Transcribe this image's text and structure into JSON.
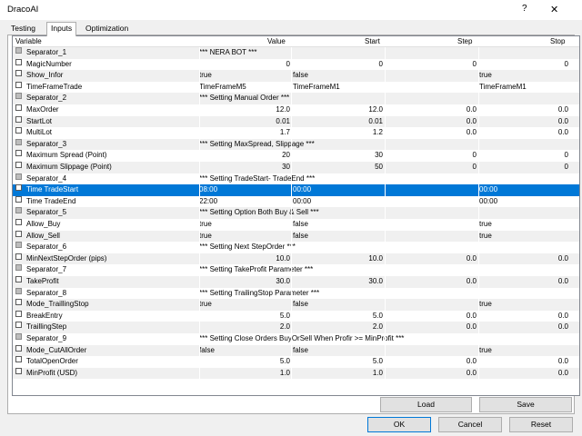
{
  "window": {
    "title": "DracoAI",
    "help": "?",
    "close": "✕"
  },
  "tabs": [
    {
      "label": "Testing"
    },
    {
      "label": "Inputs"
    },
    {
      "label": "Optimization"
    }
  ],
  "columns": {
    "variable": "Variable",
    "value": "Value",
    "start": "Start",
    "step": "Step",
    "stop": "Stop"
  },
  "rows": [
    {
      "name": "Separator_1",
      "value": "*** NERA BOT ***",
      "start": "",
      "step": "",
      "stop": "",
      "sep": true
    },
    {
      "name": "MagicNumber",
      "value": "0",
      "start": "0",
      "step": "0",
      "stop": "0"
    },
    {
      "name": "Show_Infor",
      "value": "true",
      "start": "false",
      "step": "",
      "stop": "true"
    },
    {
      "name": "TimeFrameTrade",
      "value": "TimeFrameM5",
      "start": "TimeFrameM1",
      "step": "",
      "stop": "TimeFrameM1"
    },
    {
      "name": "Separator_2",
      "value": "*** Setting Manual Order ***",
      "start": "",
      "step": "",
      "stop": "",
      "sep": true
    },
    {
      "name": "MaxOrder",
      "value": "12.0",
      "start": "12.0",
      "step": "0.0",
      "stop": "0.0"
    },
    {
      "name": "StartLot",
      "value": "0.01",
      "start": "0.01",
      "step": "0.0",
      "stop": "0.0"
    },
    {
      "name": "MultiLot",
      "value": "1.7",
      "start": "1.2",
      "step": "0.0",
      "stop": "0.0"
    },
    {
      "name": "Separator_3",
      "value": "*** Setting MaxSpread, Slippage ***",
      "start": "",
      "step": "",
      "stop": "",
      "sep": true
    },
    {
      "name": "Maximum Spread (Point)",
      "value": "20",
      "start": "30",
      "step": "0",
      "stop": "0"
    },
    {
      "name": "Maximum Slippage (Point)",
      "value": "30",
      "start": "50",
      "step": "0",
      "stop": "0"
    },
    {
      "name": "Separator_4",
      "value": "*** Setting TradeStart- TradeEnd ***",
      "start": "",
      "step": "",
      "stop": "",
      "sep": true
    },
    {
      "name": "Time TradeStart",
      "value": "08:00",
      "start": "00:00",
      "step": "",
      "stop": "00:00",
      "selected": true
    },
    {
      "name": "Time TradeEnd",
      "value": "22:00",
      "start": "00:00",
      "step": "",
      "stop": "00:00"
    },
    {
      "name": "Separator_5",
      "value": "*** Setting Option Both Buy & Sell ***",
      "start": "",
      "step": "",
      "stop": "",
      "sep": true
    },
    {
      "name": "Allow_Buy",
      "value": "true",
      "start": "false",
      "step": "",
      "stop": "true"
    },
    {
      "name": "Allow_Sell",
      "value": "true",
      "start": "false",
      "step": "",
      "stop": "true"
    },
    {
      "name": "Separator_6",
      "value": "*** Setting Next StepOrder ***",
      "start": "",
      "step": "",
      "stop": "",
      "sep": true
    },
    {
      "name": "MinNextStepOrder (pips)",
      "value": "10.0",
      "start": "10.0",
      "step": "0.0",
      "stop": "0.0"
    },
    {
      "name": "Separator_7",
      "value": "*** Setting TakeProfit Parameter ***",
      "start": "",
      "step": "",
      "stop": "",
      "sep": true
    },
    {
      "name": "TakeProfit",
      "value": "30.0",
      "start": "30.0",
      "step": "0.0",
      "stop": "0.0"
    },
    {
      "name": "Separator_8",
      "value": "*** Setting TrailingStop Parameter ***",
      "start": "",
      "step": "",
      "stop": "",
      "sep": true
    },
    {
      "name": "Mode_TraillingStop",
      "value": "true",
      "start": "false",
      "step": "",
      "stop": "true"
    },
    {
      "name": "BreakEntry",
      "value": "5.0",
      "start": "5.0",
      "step": "0.0",
      "stop": "0.0"
    },
    {
      "name": "TraillingStep",
      "value": "2.0",
      "start": "2.0",
      "step": "0.0",
      "stop": "0.0"
    },
    {
      "name": "Separator_9",
      "value": "*** Setting Close Orders BuyOrSell When Profir >= MinProfit ***",
      "start": "",
      "step": "",
      "stop": "",
      "sep": true
    },
    {
      "name": "Mode_CutAllOrder",
      "value": "false",
      "start": "false",
      "step": "",
      "stop": "true"
    },
    {
      "name": "TotalOpenOrder",
      "value": "5.0",
      "start": "5.0",
      "step": "0.0",
      "stop": "0.0"
    },
    {
      "name": "MinProfit (USD)",
      "value": "1.0",
      "start": "1.0",
      "step": "0.0",
      "stop": "0.0"
    }
  ],
  "buttons": {
    "load": "Load",
    "save": "Save",
    "ok": "OK",
    "cancel": "Cancel",
    "reset": "Reset"
  }
}
